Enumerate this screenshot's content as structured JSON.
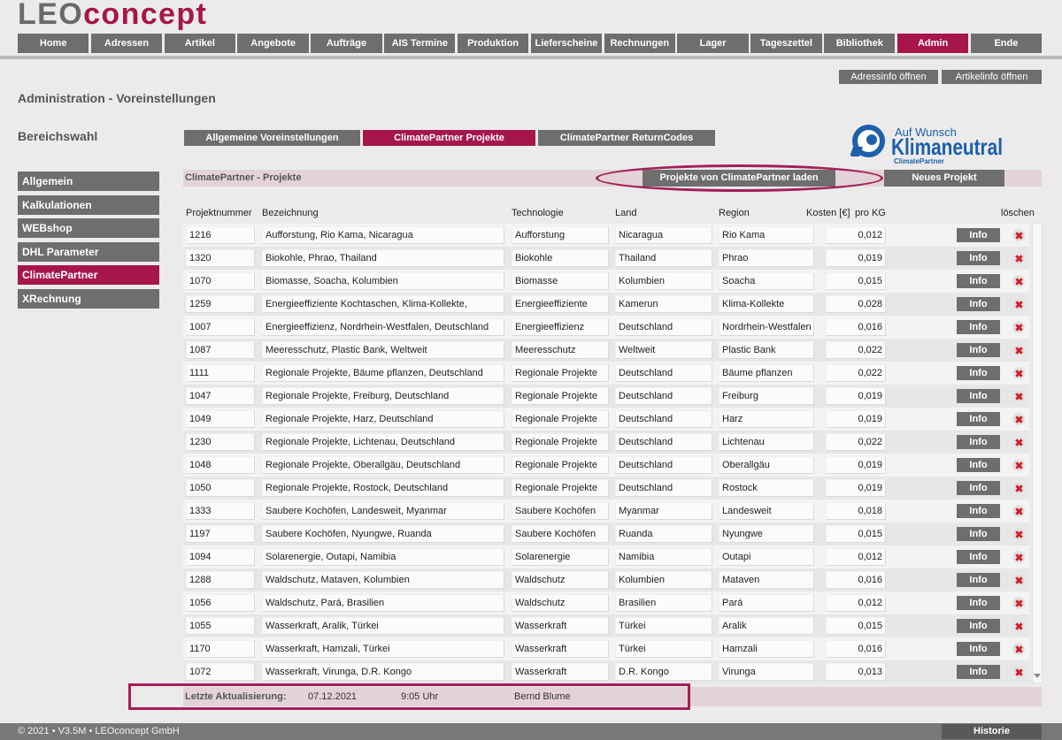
{
  "logo": {
    "part1": "LEO",
    "part2": "concept"
  },
  "colors": {
    "accent": "#a7164b",
    "button_gray": "#6e6e6e",
    "button_dark": "#595959",
    "panel_pink": "#e3d3d9",
    "badge_blue": "#1d5fa9",
    "delete_red": "#d1202a",
    "annotation": "#a31f57",
    "page_bg": "#ebebeb"
  },
  "icons": {
    "delete": "delete-icon",
    "scroll_down": "chevron-down-icon",
    "badge": "climatepartner-logo-icon"
  },
  "nav": {
    "items": [
      {
        "label": "Home"
      },
      {
        "label": "Adressen"
      },
      {
        "label": "Artikel"
      },
      {
        "label": "Angebote"
      },
      {
        "label": "Aufträge"
      },
      {
        "label": "AIS Termine"
      },
      {
        "label": "Produktion"
      },
      {
        "label": "Lieferscheine"
      },
      {
        "label": "Rechnungen"
      },
      {
        "label": "Lager"
      },
      {
        "label": "Tageszettel"
      },
      {
        "label": "Bibliothek"
      },
      {
        "label": "Admin",
        "active": true
      },
      {
        "label": "Ende"
      }
    ]
  },
  "top_buttons": {
    "adressinfo": "Adressinfo öffnen",
    "artikelinfo": "Artikelinfo öffnen"
  },
  "page_title": "Administration - Voreinstellungen",
  "sidebar": {
    "title": "Bereichswahl",
    "items": [
      {
        "label": "Allgemein"
      },
      {
        "label": "Kalkulationen"
      },
      {
        "label": "WEBshop"
      },
      {
        "label": "DHL Parameter"
      },
      {
        "label": "ClimatePartner",
        "active": true
      },
      {
        "label": "XRechnung"
      }
    ]
  },
  "tabs": {
    "items": [
      {
        "label": "Allgemeine Voreinstellungen"
      },
      {
        "label": "ClimatePartner Projekte",
        "active": true
      },
      {
        "label": "ClimatePartner ReturnCodes"
      }
    ]
  },
  "badge": {
    "line1": "Auf Wunsch",
    "line2": "Klimaneutral",
    "line3": "ClimatePartner"
  },
  "panel": {
    "title": "ClimatePartner - Projekte",
    "load_button": "Projekte von ClimatePartner laden",
    "new_button": "Neues Projekt"
  },
  "table": {
    "columns": {
      "nr": "Projektnummer",
      "bezeichnung": "Bezeichnung",
      "technologie": "Technologie",
      "land": "Land",
      "region": "Region",
      "kosten": "Kosten [€]",
      "pro_kg": "pro KG",
      "loeschen": "löschen"
    },
    "info_label": "Info",
    "rows": [
      {
        "nr": "1216",
        "bezeichnung": "Aufforstung, Rio Kama, Nicaragua",
        "technologie": "Aufforstung",
        "land": "Nicaragua",
        "region": "Rio Kama",
        "kosten": "0,012"
      },
      {
        "nr": "1320",
        "bezeichnung": "Biokohle, Phrao, Thailand",
        "technologie": "Biokohle",
        "land": "Thailand",
        "region": "Phrao",
        "kosten": "0,019"
      },
      {
        "nr": "1070",
        "bezeichnung": "Biomasse, Soacha, Kolumbien",
        "technologie": "Biomasse",
        "land": "Kolumbien",
        "region": "Soacha",
        "kosten": "0,015"
      },
      {
        "nr": "1259",
        "bezeichnung": "Energieeffiziente Kochtaschen, Klima-Kollekte,",
        "technologie": "Energieeffiziente",
        "land": "Kamerun",
        "region": "Klima-Kollekte",
        "kosten": "0,028"
      },
      {
        "nr": "1007",
        "bezeichnung": "Energieeffizienz, Nordrhein-Westfalen, Deutschland",
        "technologie": "Energieeffizienz",
        "land": "Deutschland",
        "region": "Nordrhein-Westfalen",
        "kosten": "0,016"
      },
      {
        "nr": "1087",
        "bezeichnung": "Meeresschutz, Plastic Bank, Weltweit",
        "technologie": "Meeresschutz",
        "land": "Weltweit",
        "region": "Plastic Bank",
        "kosten": "0,022"
      },
      {
        "nr": "1111",
        "bezeichnung": "Regionale Projekte, Bäume pflanzen, Deutschland",
        "technologie": "Regionale Projekte",
        "land": "Deutschland",
        "region": "Bäume pflanzen",
        "kosten": "0,022"
      },
      {
        "nr": "1047",
        "bezeichnung": "Regionale Projekte, Freiburg, Deutschland",
        "technologie": "Regionale Projekte",
        "land": "Deutschland",
        "region": "Freiburg",
        "kosten": "0,019"
      },
      {
        "nr": "1049",
        "bezeichnung": "Regionale Projekte, Harz, Deutschland",
        "technologie": "Regionale Projekte",
        "land": "Deutschland",
        "region": "Harz",
        "kosten": "0,019"
      },
      {
        "nr": "1230",
        "bezeichnung": "Regionale Projekte, Lichtenau, Deutschland",
        "technologie": "Regionale Projekte",
        "land": "Deutschland",
        "region": "Lichtenau",
        "kosten": "0,022"
      },
      {
        "nr": "1048",
        "bezeichnung": "Regionale Projekte, Oberallgäu, Deutschland",
        "technologie": "Regionale Projekte",
        "land": "Deutschland",
        "region": "Oberallgäu",
        "kosten": "0,019"
      },
      {
        "nr": "1050",
        "bezeichnung": "Regionale Projekte, Rostock, Deutschland",
        "technologie": "Regionale Projekte",
        "land": "Deutschland",
        "region": "Rostock",
        "kosten": "0,019"
      },
      {
        "nr": "1333",
        "bezeichnung": "Saubere Kochöfen, Landesweit, Myanmar",
        "technologie": "Saubere Kochöfen",
        "land": "Myanmar",
        "region": "Landesweit",
        "kosten": "0,018"
      },
      {
        "nr": "1197",
        "bezeichnung": "Saubere Kochöfen, Nyungwe, Ruanda",
        "technologie": "Saubere Kochöfen",
        "land": "Ruanda",
        "region": "Nyungwe",
        "kosten": "0,015"
      },
      {
        "nr": "1094",
        "bezeichnung": "Solarenergie, Outapi, Namibia",
        "technologie": "Solarenergie",
        "land": "Namibia",
        "region": "Outapi",
        "kosten": "0,012"
      },
      {
        "nr": "1288",
        "bezeichnung": "Waldschutz, Mataven, Kolumbien",
        "technologie": "Waldschutz",
        "land": "Kolumbien",
        "region": "Mataven",
        "kosten": "0,016"
      },
      {
        "nr": "1056",
        "bezeichnung": "Waldschutz, Pará, Brasilien",
        "technologie": "Waldschutz",
        "land": "Brasilien",
        "region": "Pará",
        "kosten": "0,012"
      },
      {
        "nr": "1055",
        "bezeichnung": "Wasserkraft, Aralik, Türkei",
        "technologie": "Wasserkraft",
        "land": "Türkei",
        "region": "Aralik",
        "kosten": "0,015"
      },
      {
        "nr": "1170",
        "bezeichnung": "Wasserkraft, Hamzali, Türkei",
        "technologie": "Wasserkraft",
        "land": "Türkei",
        "region": "Hamzali",
        "kosten": "0,016"
      },
      {
        "nr": "1072",
        "bezeichnung": "Wasserkraft, Virunga, D.R. Kongo",
        "technologie": "Wasserkraft",
        "land": "D.R. Kongo",
        "region": "Virunga",
        "kosten": "0,013"
      }
    ]
  },
  "last_update": {
    "label": "Letzte Aktualisierung:",
    "date": "07.12.2021",
    "time": "9:05 Uhr",
    "user": "Bernd Blume"
  },
  "footer": {
    "copyright": "© 2021 • V3.5M • LEOconcept GmbH",
    "history_button": "Historie"
  }
}
